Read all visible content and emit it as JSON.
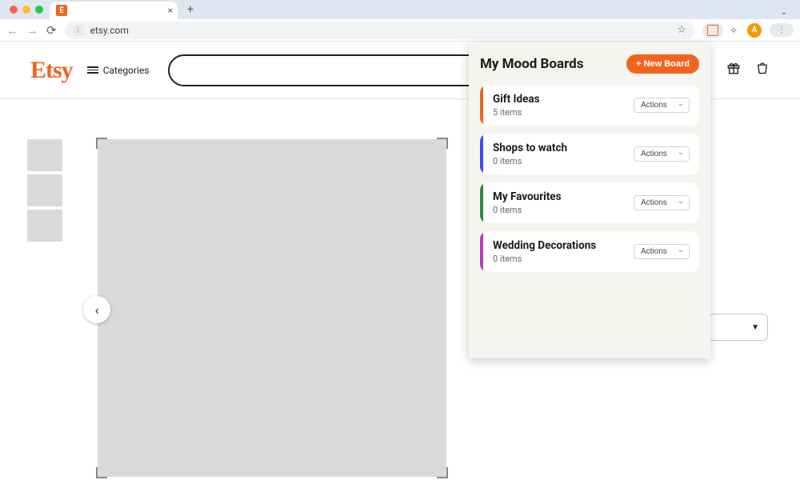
{
  "browser": {
    "tab_title": "",
    "url": "etsy.com",
    "avatar_initial": "A"
  },
  "site": {
    "logo": "Etsy",
    "categories_label": "Categories"
  },
  "panel": {
    "title": "My Mood Boards",
    "new_board_label": "+ New Board",
    "actions_label": "Actions",
    "boards": [
      {
        "name": "Gift Ideas",
        "count": "5 items",
        "color": "#f1641e"
      },
      {
        "name": "Shops to watch",
        "count": "0 items",
        "color": "#3b4cff"
      },
      {
        "name": "My Favourites",
        "count": "0 items",
        "color": "#2a8a3a"
      },
      {
        "name": "Wedding Decorations",
        "count": "0 items",
        "color": "#b53ab8"
      }
    ]
  }
}
